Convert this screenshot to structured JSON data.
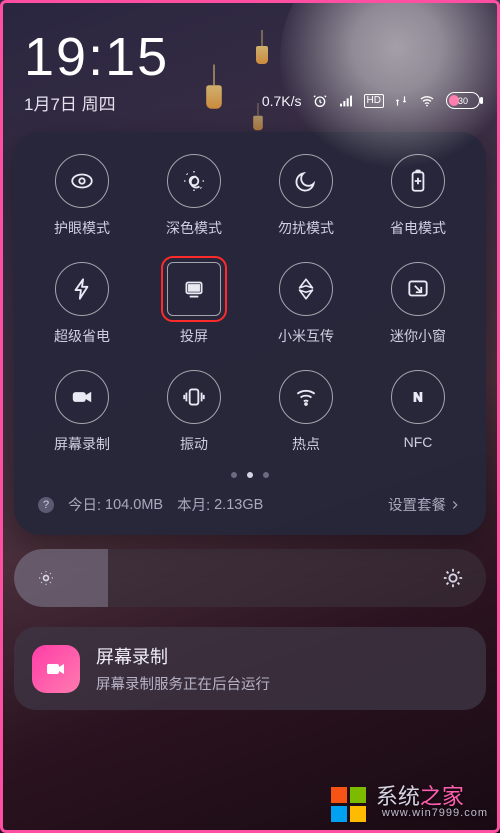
{
  "status": {
    "time": "19:15",
    "date": "1月7日 周四",
    "net_speed": "0.7K/s",
    "hd_label": "HD",
    "battery_percent": "30"
  },
  "tiles": [
    {
      "id": "eye-care",
      "label": "护眼模式",
      "icon": "eye-icon"
    },
    {
      "id": "dark-mode",
      "label": "深色模式",
      "icon": "sun-moon-icon"
    },
    {
      "id": "dnd",
      "label": "勿扰模式",
      "icon": "moon-icon"
    },
    {
      "id": "battery-saver",
      "label": "省电模式",
      "icon": "battery-plus-icon"
    },
    {
      "id": "ultra-saver",
      "label": "超级省电",
      "icon": "bolt-icon"
    },
    {
      "id": "cast",
      "label": "投屏",
      "icon": "cast-icon",
      "highlighted": true
    },
    {
      "id": "mi-share",
      "label": "小米互传",
      "icon": "share-icon"
    },
    {
      "id": "mini-window",
      "label": "迷你小窗",
      "icon": "pip-icon"
    },
    {
      "id": "screen-record",
      "label": "屏幕录制",
      "icon": "video-icon"
    },
    {
      "id": "vibrate",
      "label": "振动",
      "icon": "vibrate-icon"
    },
    {
      "id": "hotspot",
      "label": "热点",
      "icon": "wifi-icon"
    },
    {
      "id": "nfc",
      "label": "NFC",
      "icon": "nfc-icon"
    }
  ],
  "pager": {
    "count": 3,
    "active_index": 1
  },
  "data_usage": {
    "today_label": "今日:",
    "today_value": "104.0MB",
    "month_label": "本月:",
    "month_value": "2.13GB",
    "plan_link": "设置套餐"
  },
  "brightness_icons": {
    "low": "brightness-low-icon",
    "high": "brightness-high-icon"
  },
  "notification": {
    "app_icon": "recorder-app-icon",
    "title": "屏幕录制",
    "body": "屏幕录制服务正在后台运行"
  },
  "watermark": {
    "text_a": "系统",
    "text_b": "之家",
    "url": "www.win7999.com"
  },
  "colors": {
    "accent_pink": "#ff4fa3",
    "highlight_red": "#ff2b2b",
    "panel_bg": "#262639"
  }
}
